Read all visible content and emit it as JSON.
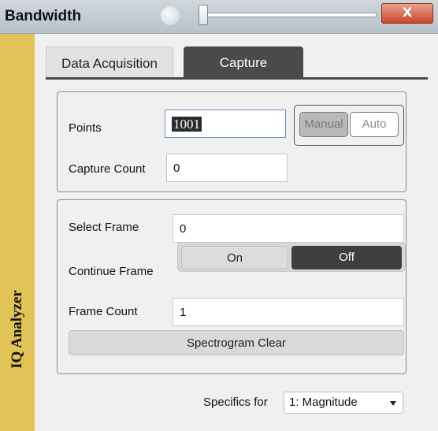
{
  "window": {
    "title": "Bandwidth",
    "close_label": "X",
    "side_label": "IQ Analyzer"
  },
  "tabs": [
    {
      "label": "Data Acquisition",
      "active": false
    },
    {
      "label": "Capture",
      "active": true
    }
  ],
  "capture": {
    "points_label": "Points",
    "points_value": "1001",
    "mode_options": [
      "Manual",
      "Auto"
    ],
    "mode_selected": "Manual",
    "capture_count_label": "Capture Count",
    "capture_count_value": "0"
  },
  "frames": {
    "select_frame_label": "Select Frame",
    "select_frame_value": "0",
    "continue_frame_label": "Continue Frame",
    "continue_frame_options": [
      "On",
      "Off"
    ],
    "continue_frame_selected": "Off",
    "frame_count_label": "Frame Count",
    "frame_count_value": "1",
    "spectrogram_clear_label": "Spectrogram Clear"
  },
  "specifics": {
    "label": "Specifics for",
    "selected": "1: Magnitude"
  },
  "colors": {
    "side_strip": "#e2c358",
    "active_tab": "#4a4a4a",
    "close_button": "#c8472c"
  }
}
